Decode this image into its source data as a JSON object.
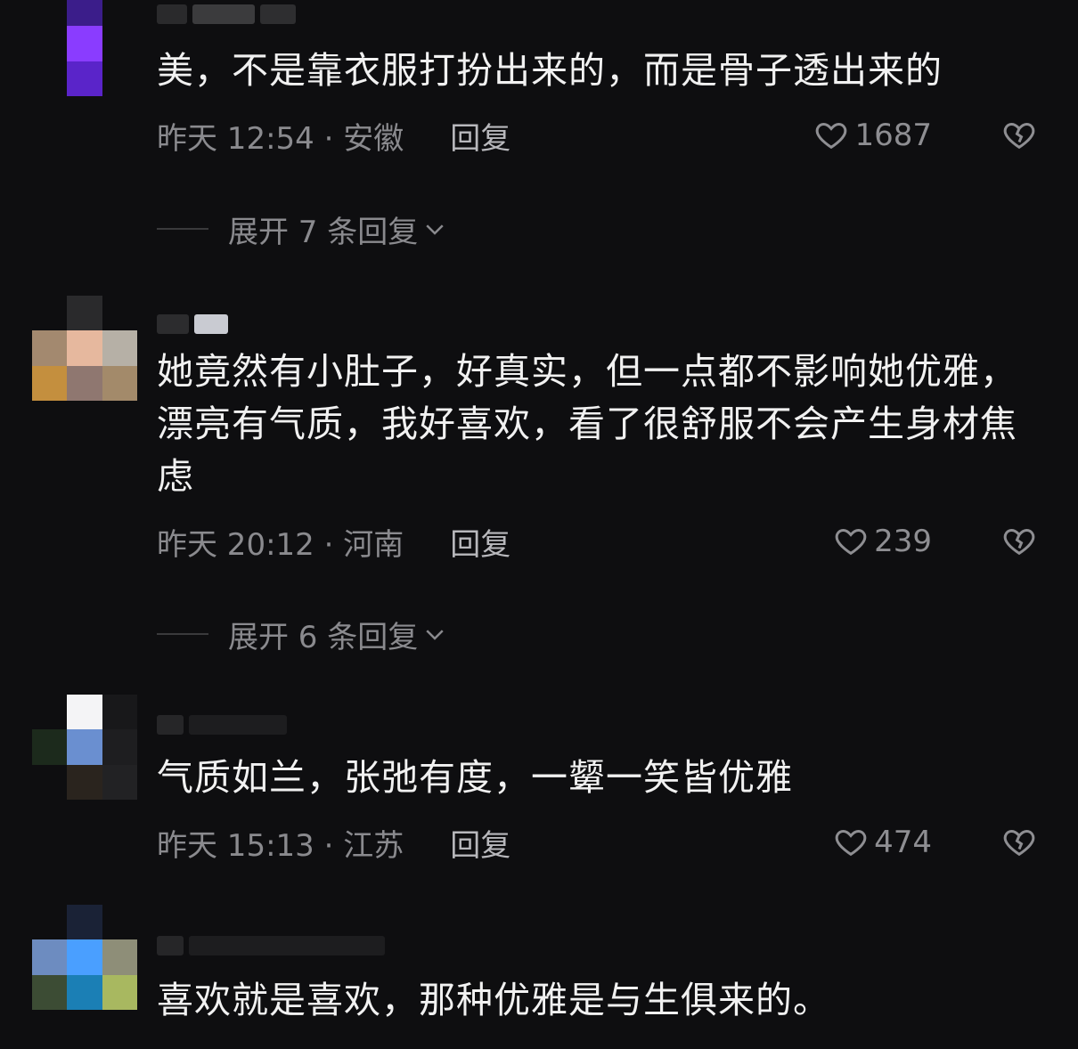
{
  "comments": [
    {
      "text": "美，不是靠衣服打扮出来的，而是骨子透出来的",
      "time": "昨天 12:54 · 安徽",
      "reply_label": "回复",
      "likes": "1687",
      "expand_label": "展开 7 条回复"
    },
    {
      "text": "她竟然有小肚子，好真实，但一点都不影响她优雅，漂亮有气质，我好喜欢，看了很舒服不会产生身材焦虑",
      "time": "昨天 20:12 · 河南",
      "reply_label": "回复",
      "likes": "239",
      "expand_label": "展开 6 条回复"
    },
    {
      "text": "气质如兰，张弛有度，一颦一笑皆优雅",
      "time": "昨天 15:13 · 江苏",
      "reply_label": "回复",
      "likes": "474"
    },
    {
      "text": "喜欢就是喜欢，那种优雅是与生俱来的。"
    }
  ],
  "icons": {
    "like": "heart-outline-icon",
    "dislike": "broken-heart-icon",
    "expand": "chevron-down-icon"
  },
  "colors": {
    "background": "#0e0e10",
    "text": "#f1f1f1",
    "meta": "#8a8a8e"
  }
}
